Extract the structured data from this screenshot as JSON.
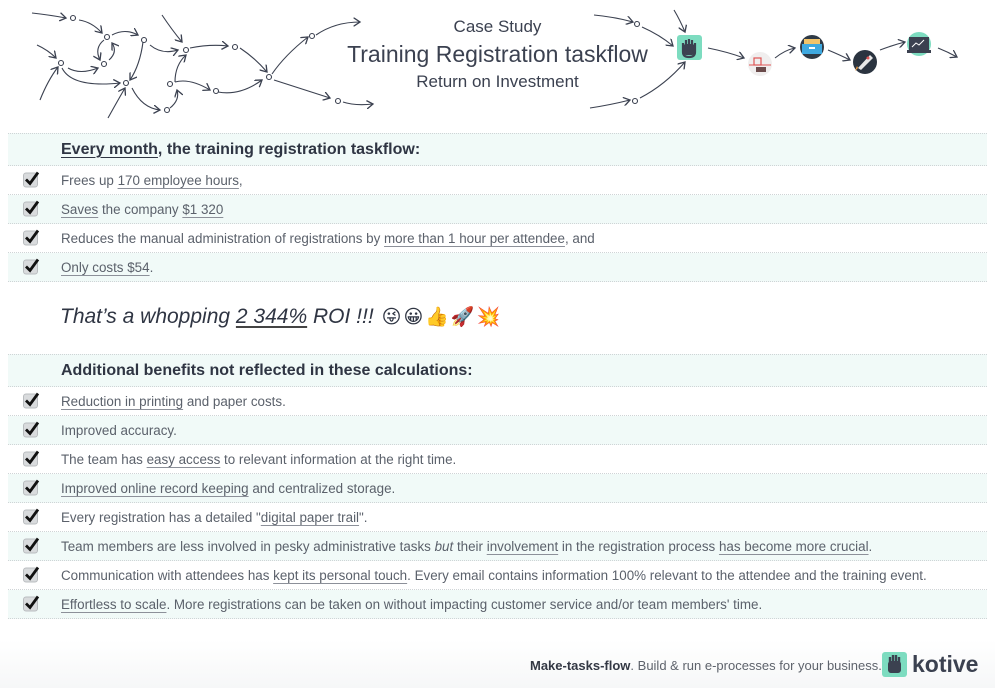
{
  "header": {
    "subtitle": "Case Study",
    "title": "Training Registration taskflow",
    "tagline": "Return on Investment",
    "flow_icons": [
      "kotive-hand-icon",
      "qr-code-icon",
      "filing-drawer-icon",
      "rocket-icon",
      "monitor-chart-icon"
    ]
  },
  "monthly": {
    "heading_underlined": "Every month",
    "heading_rest": ", the training registration taskflow:",
    "items": [
      {
        "parts": [
          {
            "t": "Frees up "
          },
          {
            "t": "170 employee hours",
            "u": true
          },
          {
            "t": ","
          }
        ]
      },
      {
        "parts": [
          {
            "t": "Saves",
            "u": true
          },
          {
            "t": " the company "
          },
          {
            "t": "$1 320",
            "u": true
          }
        ]
      },
      {
        "parts": [
          {
            "t": "Reduces the manual administration of registrations by "
          },
          {
            "t": "more than 1 hour per attendee",
            "u": true
          },
          {
            "t": ", and"
          }
        ]
      },
      {
        "parts": [
          {
            "t": "Only costs $54",
            "u": true
          },
          {
            "t": "."
          }
        ]
      }
    ]
  },
  "roi": {
    "prefix": "That’s a whopping ",
    "value": "2 344%",
    "suffix": " ROI !!!",
    "emojis": "😜😀👍🚀💥"
  },
  "additional": {
    "heading": "Additional benefits not reflected in these calculations:",
    "items": [
      {
        "parts": [
          {
            "t": "Reduction in printing",
            "u": true
          },
          {
            "t": " and paper costs."
          }
        ]
      },
      {
        "parts": [
          {
            "t": "Improved accuracy."
          }
        ]
      },
      {
        "parts": [
          {
            "t": "The team has "
          },
          {
            "t": "easy access",
            "u": true
          },
          {
            "t": " to relevant information at the right time."
          }
        ]
      },
      {
        "parts": [
          {
            "t": "Improved online record keeping",
            "u": true
          },
          {
            "t": " and centralized storage."
          }
        ]
      },
      {
        "parts": [
          {
            "t": "Every registration has a detailed \""
          },
          {
            "t": "digital paper trail",
            "u": true
          },
          {
            "t": "\"."
          }
        ]
      },
      {
        "parts": [
          {
            "t": "Team members are less involved in pesky administrative tasks "
          },
          {
            "t": "but",
            "i": true
          },
          {
            "t": " their "
          },
          {
            "t": "involvement",
            "u": true
          },
          {
            "t": " in the registration process "
          },
          {
            "t": "has become more crucial",
            "u": true
          },
          {
            "t": "."
          }
        ]
      },
      {
        "parts": [
          {
            "t": "Communication with attendees has "
          },
          {
            "t": "kept its personal touch",
            "u": true
          },
          {
            "t": ". Every email contains information 100% relevant to the attendee and the training event."
          }
        ]
      },
      {
        "parts": [
          {
            "t": "Effortless to scale",
            "u": true
          },
          {
            "t": ". More registrations can be taken on without impacting customer service and/or team members' time."
          }
        ]
      }
    ]
  },
  "footer": {
    "slogan_bold": "Make-tasks-flow",
    "slogan_rest": ". Build & run e-processes for your business.",
    "brand": "kotive"
  },
  "colors": {
    "accent": "#7ddcc0",
    "row_shade": "#f1faf8",
    "text_dark": "#2f3543"
  }
}
